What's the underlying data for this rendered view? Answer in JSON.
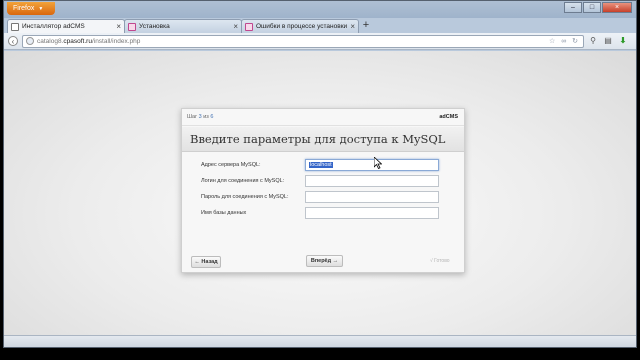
{
  "browser": {
    "app_button_label": "Firefox",
    "app_button_arrow": "▼",
    "tabs": [
      {
        "label": "Инсталлятор adCMS",
        "icon": "page-icon",
        "close": "×"
      },
      {
        "label": "Установка",
        "icon": "site-favicon",
        "close": "×"
      },
      {
        "label": "Ошибки в процессе установки",
        "icon": "site-favicon",
        "close": "×"
      }
    ],
    "new_tab_label": "+",
    "url_prefix": "catalog8.",
    "url_domain": "cpasoft.ru",
    "url_path": "/install/index.php",
    "url_right_icons": "☆ ∞ ↻",
    "nav_icons": {
      "back": "back-icon",
      "search": "search-icon",
      "menu": "bookmarks-menu-icon",
      "download": "download-icon"
    },
    "window_buttons": [
      "–",
      "□",
      "×"
    ]
  },
  "installer": {
    "step_prefix": "Шаг",
    "step_current": "3",
    "step_of": "из",
    "step_total": "6",
    "brand": "adCMS",
    "title": "Введите параметры для доступа к MySQL",
    "fields": [
      {
        "label": "Адрес сервера MySQL:",
        "value": "localhost",
        "selected": true
      },
      {
        "label": "Логин для соединения с MySQL:",
        "value": ""
      },
      {
        "label": "Пароль для соединения с MySQL:",
        "value": ""
      },
      {
        "label": "Имя базы данных",
        "value": ""
      }
    ],
    "back_label": "← Назад",
    "next_label": "Вперёд →",
    "done_label": "√ Готово"
  }
}
